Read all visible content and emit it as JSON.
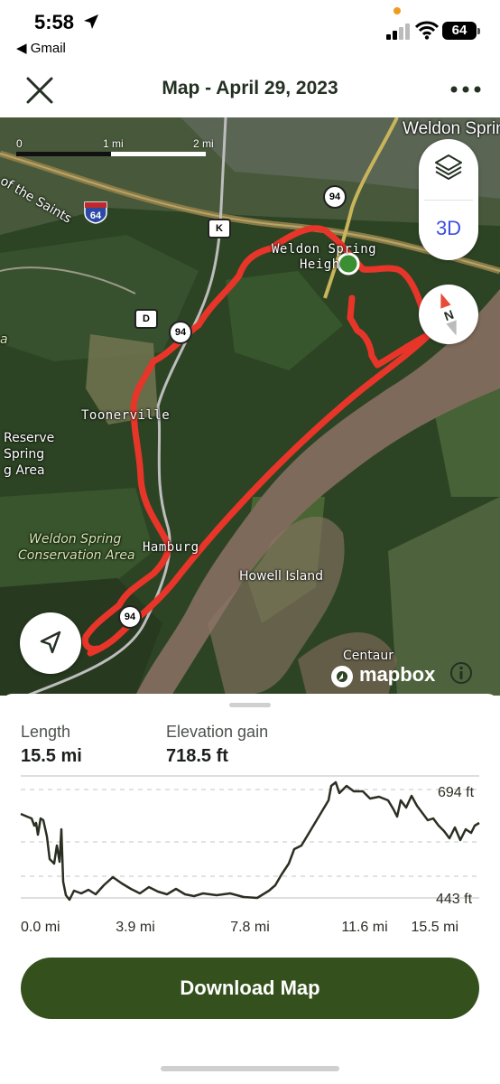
{
  "status_bar": {
    "time": "5:58",
    "back_app": "◀ Gmail",
    "battery": "64"
  },
  "header": {
    "title": "Map - April 29, 2023"
  },
  "map": {
    "scale": {
      "start": "0",
      "mid": "1 mi",
      "end": "2 mi"
    },
    "labels": {
      "weldon_spring": "Weldon Spring",
      "weldon_spring_heights_1": "Weldon Spring",
      "weldon_spring_heights_2": "Heigh",
      "trail_of_saints": "e of the Saints",
      "toonerville": "Toonerville",
      "reserve_1": "Reserve",
      "reserve_2": "Spring",
      "reserve_3": "g Area",
      "conservation_1": "Weldon Spring",
      "conservation_2": "Conservation Area",
      "hamburg": "Hamburg",
      "howell_island": "Howell Island",
      "centaur": "Centaur",
      "edge_a": "a"
    },
    "shields": {
      "hwy94_top": "94",
      "hwy94_mid": "94",
      "hwy94_bottom": "94",
      "route_k": "K",
      "route_d": "D",
      "interstate": "64"
    },
    "controls": {
      "mode_3d": "3D"
    },
    "attribution": "mapbox",
    "route_color": "#e8352a",
    "start_marker_color": "#3b8f33"
  },
  "stats": {
    "length_label": "Length",
    "length_value": "15.5 mi",
    "elevation_label": "Elevation gain",
    "elevation_value": "718.5 ft"
  },
  "elevation_chart": {
    "y_max_label": "694 ft",
    "y_min_label": "443 ft",
    "x_labels": [
      "0.0 mi",
      "3.9 mi",
      "7.8 mi",
      "11.6 mi",
      "15.5 mi"
    ],
    "line_color": "#2a2f22"
  },
  "actions": {
    "download_label": "Download Map"
  }
}
